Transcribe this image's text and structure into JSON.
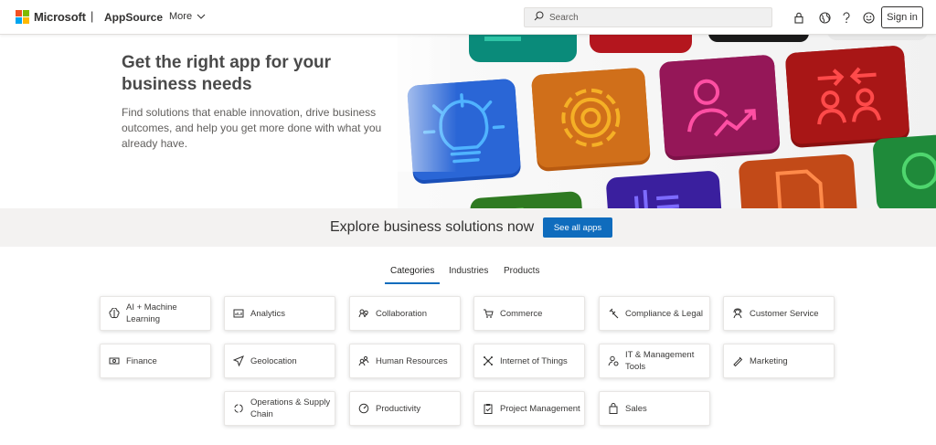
{
  "header": {
    "brand": "Microsoft",
    "separator": "|",
    "product": "AppSource",
    "more_label": "More",
    "search_placeholder": "Search",
    "signin_label": "Sign in",
    "icons": [
      "lock-icon",
      "globe-icon",
      "help-icon",
      "feedback-smiley-icon"
    ]
  },
  "hero": {
    "title": "Get the right app for your business needs",
    "subtitle": "Find solutions that enable innovation, drive business outcomes, and help you get more done with what you already have."
  },
  "explore": {
    "text": "Explore business solutions now",
    "button": "See all apps"
  },
  "tabs": [
    {
      "label": "Categories",
      "active": true
    },
    {
      "label": "Industries",
      "active": false
    },
    {
      "label": "Products",
      "active": false
    }
  ],
  "categories": [
    {
      "label": "AI + Machine Learning",
      "icon": "ai-brain-icon"
    },
    {
      "label": "Analytics",
      "icon": "analytics-icon"
    },
    {
      "label": "Collaboration",
      "icon": "collaboration-icon"
    },
    {
      "label": "Commerce",
      "icon": "cart-icon"
    },
    {
      "label": "Compliance & Legal",
      "icon": "gavel-icon"
    },
    {
      "label": "Customer Service",
      "icon": "headset-icon"
    },
    {
      "label": "Finance",
      "icon": "money-icon"
    },
    {
      "label": "Geolocation",
      "icon": "location-arrow-icon"
    },
    {
      "label": "Human Resources",
      "icon": "people-icon"
    },
    {
      "label": "Internet of Things",
      "icon": "iot-icon"
    },
    {
      "label": "IT & Management Tools",
      "icon": "person-settings-icon"
    },
    {
      "label": "Marketing",
      "icon": "marketing-icon"
    },
    {
      "label": "Operations & Supply Chain",
      "icon": "cycle-icon"
    },
    {
      "label": "Productivity",
      "icon": "speedometer-icon"
    },
    {
      "label": "Project Management",
      "icon": "clipboard-icon"
    },
    {
      "label": "Sales",
      "icon": "shopping-bag-icon"
    }
  ],
  "colors": {
    "accent": "#0f6cbd",
    "explore_band": "#f3f2f1",
    "logo_red": "#f25022",
    "logo_green": "#7fba00",
    "logo_blue": "#00a4ef",
    "logo_yellow": "#ffb900"
  }
}
